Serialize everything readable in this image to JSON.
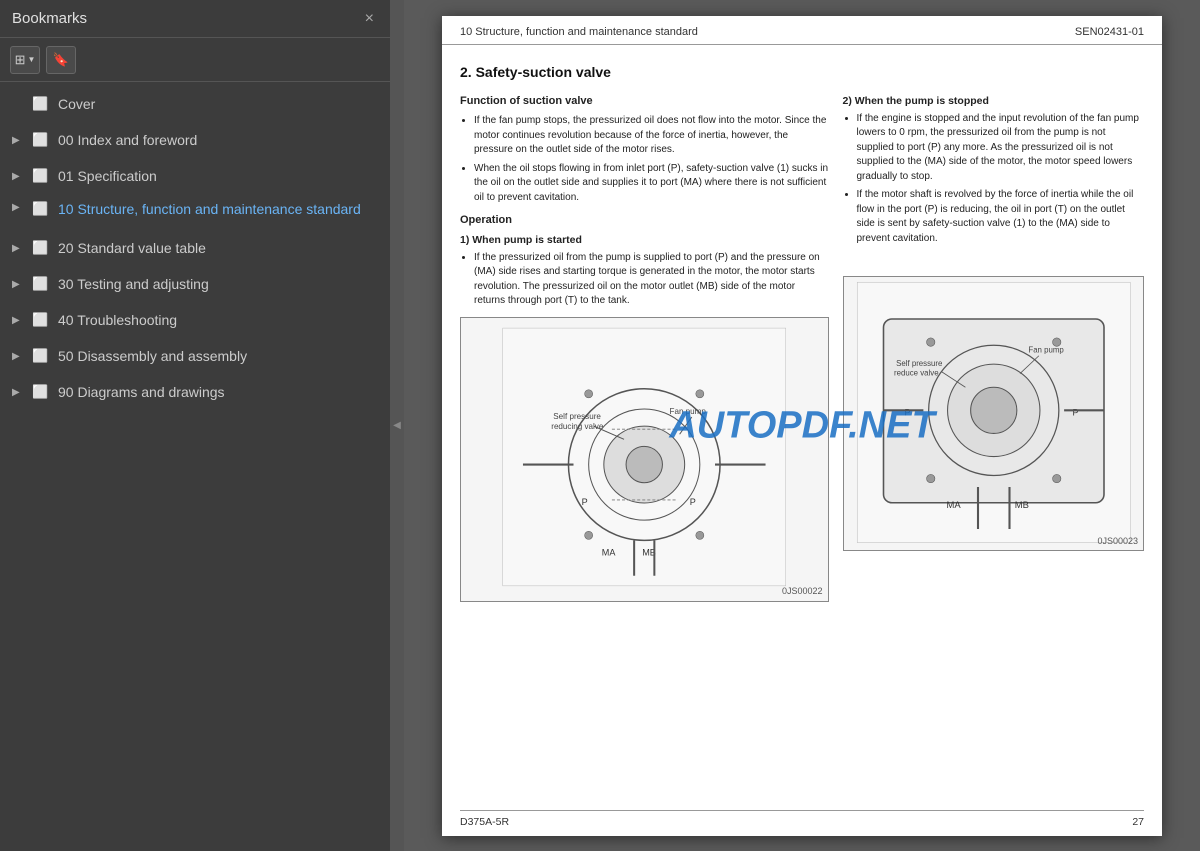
{
  "sidebar": {
    "title": "Bookmarks",
    "close_label": "×",
    "toolbar": {
      "view_btn_icon": "⊞",
      "bookmark_btn_icon": "🔖"
    },
    "items": [
      {
        "id": "cover",
        "label": "Cover",
        "has_children": false,
        "active": false,
        "expanded": false
      },
      {
        "id": "00-index",
        "label": "00 Index and foreword",
        "has_children": true,
        "active": false,
        "expanded": false
      },
      {
        "id": "01-spec",
        "label": "01 Specification",
        "has_children": true,
        "active": false,
        "expanded": false
      },
      {
        "id": "10-structure",
        "label": "10 Structure, function and maintenance standard",
        "has_children": true,
        "active": true,
        "expanded": true
      },
      {
        "id": "20-standard",
        "label": "20 Standard value table",
        "has_children": true,
        "active": false,
        "expanded": false
      },
      {
        "id": "30-testing",
        "label": "30 Testing and adjusting",
        "has_children": true,
        "active": false,
        "expanded": false
      },
      {
        "id": "40-trouble",
        "label": "40 Troubleshooting",
        "has_children": true,
        "active": false,
        "expanded": false
      },
      {
        "id": "50-disassembly",
        "label": "50 Disassembly and assembly",
        "has_children": true,
        "active": false,
        "expanded": false
      },
      {
        "id": "90-diagrams",
        "label": "90 Diagrams and drawings",
        "has_children": true,
        "active": false,
        "expanded": false
      }
    ]
  },
  "page": {
    "header_left": "10 Structure, function and maintenance standard",
    "header_right": "SEN02431-01",
    "section_title": "2.  Safety-suction valve",
    "col1_title1": "Function of suction valve",
    "col1_bullets1": [
      "If the fan pump stops, the pressurized oil does not flow into the motor. Since the motor continues revolution because of the force of inertia, however, the pressure on the outlet side of the motor rises.",
      "When the oil stops flowing in from inlet port (P), safety-suction valve (1) sucks in the oil on the outlet side and supplies it to port (MA) where there is not sufficient oil to prevent cavitation."
    ],
    "col1_op_title": "Operation",
    "col1_op1_label": "1)  When pump is started",
    "col1_op1_bullets": [
      "If the pressurized oil from the pump is supplied to port (P) and the pressure on (MA) side rises and starting torque is generated in the motor, the motor starts revolution. The pressurized oil on the motor outlet (MB) side of the motor returns through port (T) to the tank."
    ],
    "col2_title1": "2)  When the pump is stopped",
    "col2_bullets1": [
      "If the engine is stopped and the input revolution of the fan pump lowers to 0 rpm, the pressurized oil from the pump is not supplied to port (P) any more. As the pressurized oil is not supplied to the (MA) side of the motor, the motor speed lowers gradually to stop.",
      "If the motor shaft is revolved by the force of inertia while the oil flow in the port (P) is reducing, the oil in port (T) on the outlet side is sent by safety-suction valve (1) to the (MA) side to prevent cavitation."
    ],
    "diagram1_label": "0JS00022",
    "diagram2_label": "0JS00023",
    "footer_left": "D375A-5R",
    "footer_right": "27"
  }
}
